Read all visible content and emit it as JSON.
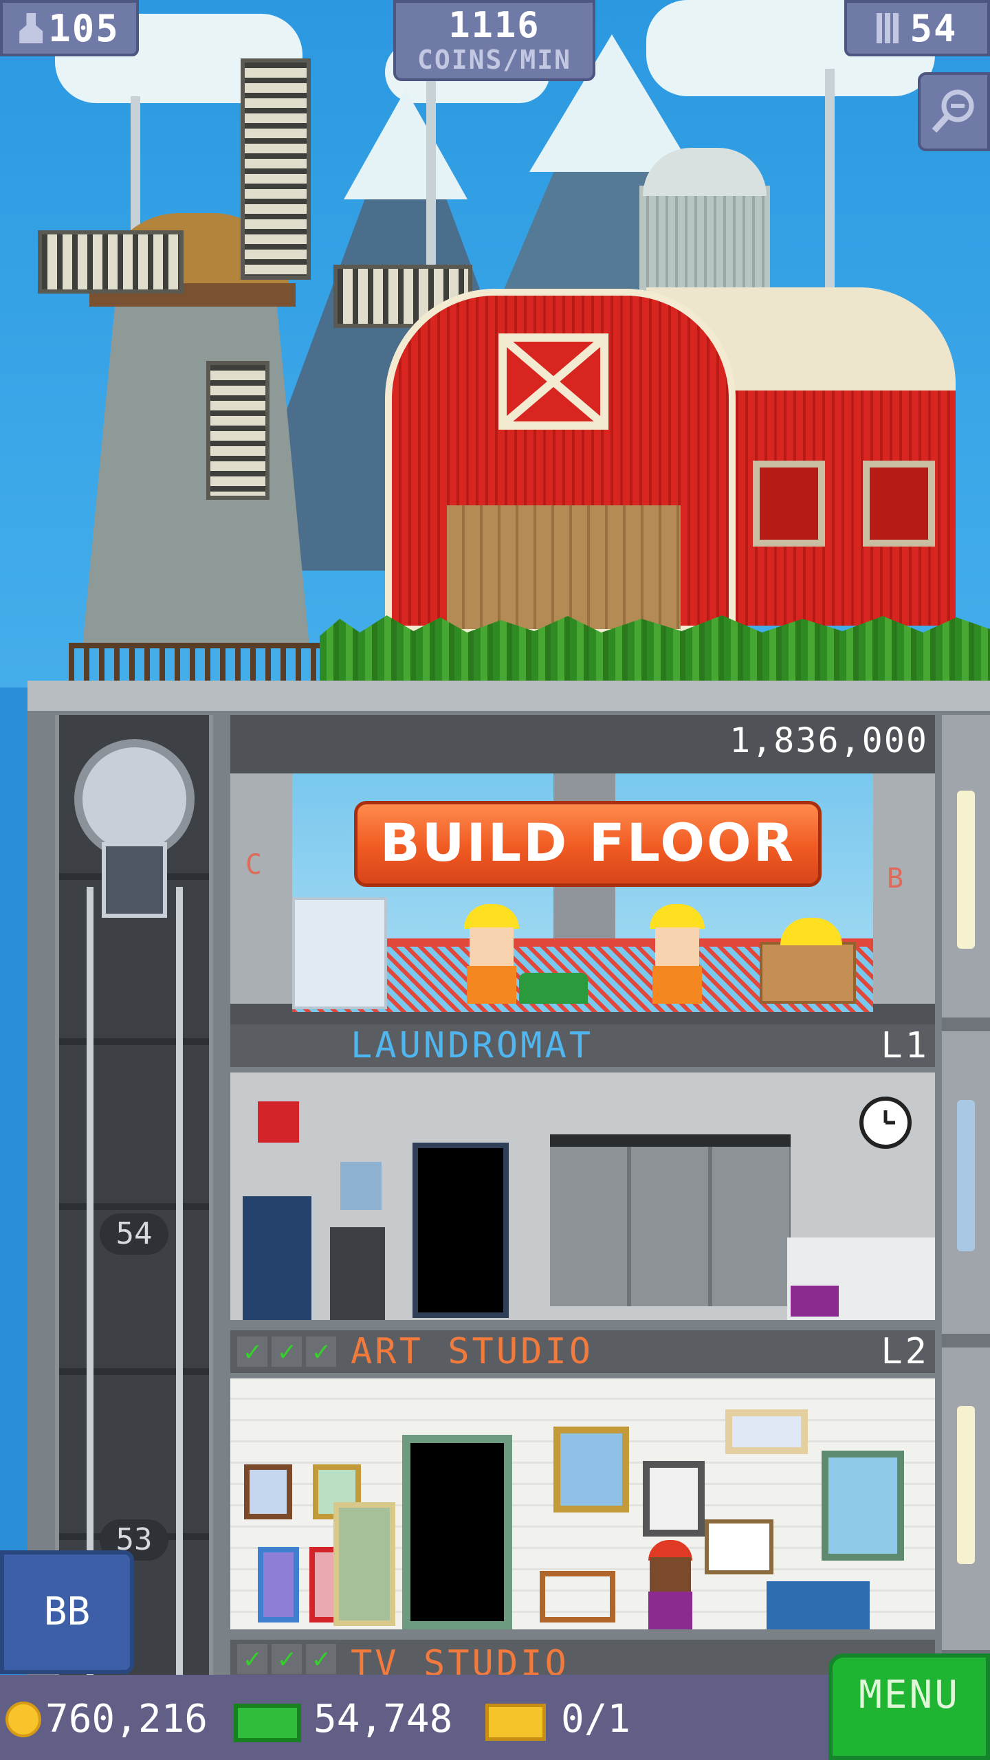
{
  "hud": {
    "population": "105",
    "coins_rate_value": "1116",
    "coins_rate_unit": "COINS/MIN",
    "floors": "54"
  },
  "construction": {
    "cost": "1,836,000",
    "button_label": "BUILD FLOOR",
    "left_letter": "C",
    "right_letter": "B"
  },
  "floors": [
    {
      "name": "LAUNDROMAT",
      "level": "L1",
      "stars": 0
    },
    {
      "name": "ART STUDIO",
      "level": "L2",
      "stars": 3
    },
    {
      "name": "TV STUDIO",
      "level": "",
      "stars": 3
    }
  ],
  "elevator": {
    "floor_markers": [
      "54",
      "53"
    ]
  },
  "bb_button": "BB",
  "bottom": {
    "coins": "760,216",
    "bux": "54,748",
    "tickets": "0/1",
    "menu": "MENU"
  },
  "colors": {
    "build_button": "#f05a22",
    "floor_name": "#f27a3d",
    "laundromat_name": "#4fb6f0",
    "menu_bg": "#1fb431"
  },
  "icons": [
    "person-icon",
    "building-icon",
    "zoom-out-icon",
    "coin-icon",
    "bux-icon",
    "ticket-icon",
    "check-icon",
    "clock-icon"
  ]
}
